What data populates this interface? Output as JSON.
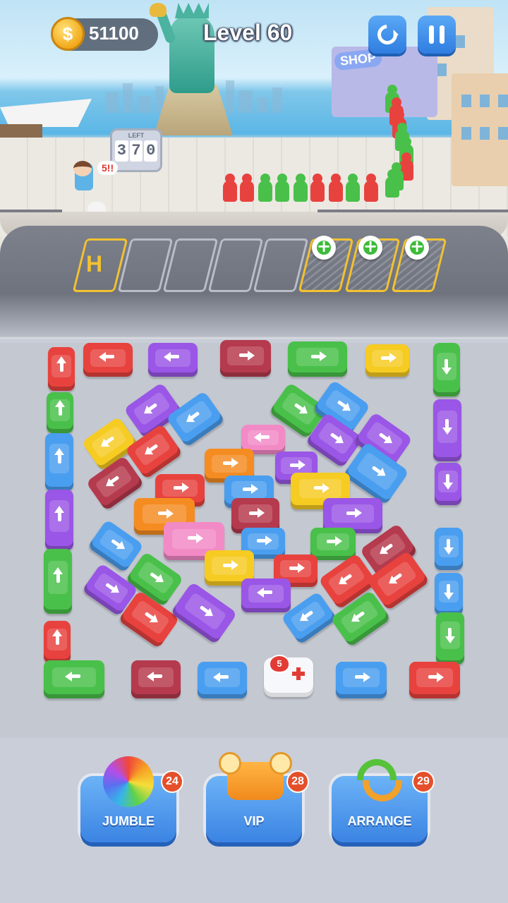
{
  "hud": {
    "coins": "51100",
    "coin_symbol": "$",
    "level": "Level 60",
    "restart_icon": "restart-icon",
    "pause_icon": "pause-icon"
  },
  "scene": {
    "shop_sign": "SHOP",
    "counter_caption": "LEFT",
    "counter_digits": [
      "3",
      "7",
      "0"
    ],
    "speech_bubble": "5!!",
    "parking_slot_letter": "H",
    "waiting_queue": [
      "red",
      "red",
      "green",
      "green",
      "green",
      "red",
      "red",
      "green",
      "red",
      "green"
    ],
    "parking_slots": [
      {
        "state": "handicap"
      },
      {
        "state": "empty"
      },
      {
        "state": "empty"
      },
      {
        "state": "empty"
      },
      {
        "state": "empty"
      },
      {
        "state": "locked-add"
      },
      {
        "state": "locked-add"
      },
      {
        "state": "locked-add"
      }
    ]
  },
  "colors": {
    "red": "#e8423e",
    "green": "#49c04a",
    "blue": "#4a9ef0",
    "purple": "#9a56e6",
    "yellow": "#f6cb22",
    "orange": "#f58c22",
    "pink": "#f28ac6",
    "maroon": "#b53a4d",
    "accent_blue": "#3b84e3",
    "badge": "#e4502b"
  },
  "board": {
    "ambulance_heart_count": "5"
  },
  "boosters": [
    {
      "id": "jumble",
      "label": "JUMBLE",
      "count": "24",
      "icon": "rainbow-ball-icon"
    },
    {
      "id": "vip",
      "label": "VIP",
      "count": "28",
      "icon": "vip-helicopter-car-icon"
    },
    {
      "id": "arrange",
      "label": "ARRANGE",
      "count": "29",
      "icon": "arrange-arrows-icon"
    }
  ]
}
